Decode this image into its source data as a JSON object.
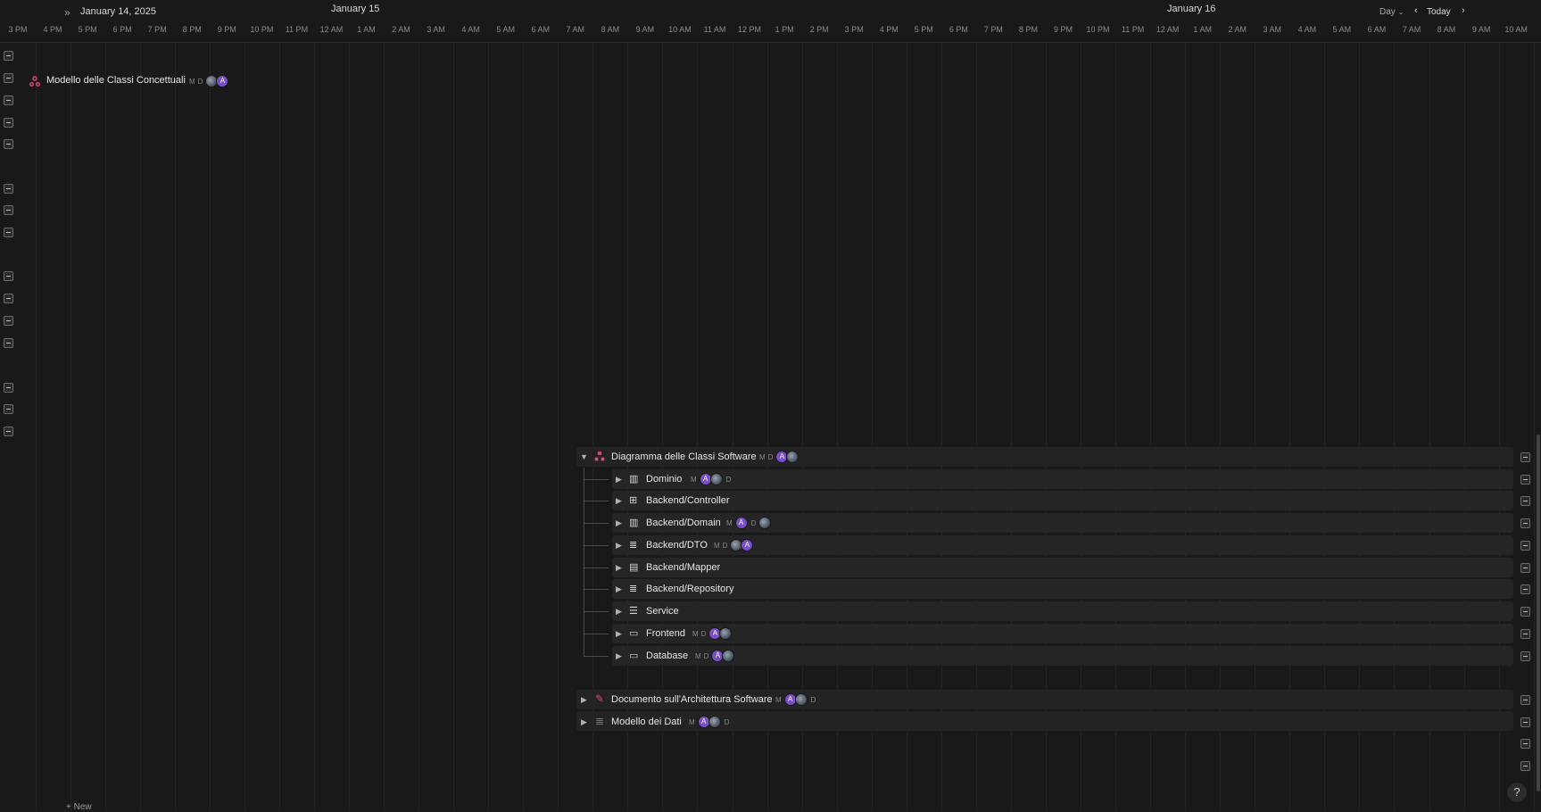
{
  "header": {
    "current_date": "January 14, 2025",
    "day_labels": [
      "January 15",
      "January 16"
    ],
    "view_mode": "Day",
    "today_label": "Today",
    "hours": [
      "3 PM",
      "4 PM",
      "5 PM",
      "6 PM",
      "7 PM",
      "8 PM",
      "9 PM",
      "10 PM",
      "11 PM",
      "12 AM",
      "1 AM",
      "2 AM",
      "3 AM",
      "4 AM",
      "5 AM",
      "6 AM",
      "7 AM",
      "8 AM",
      "9 AM",
      "10 AM",
      "11 AM",
      "12 PM",
      "1 PM",
      "2 PM",
      "3 PM",
      "4 PM",
      "5 PM",
      "6 PM",
      "7 PM",
      "8 PM",
      "9 PM",
      "10 PM",
      "11 PM",
      "12 AM",
      "1 AM",
      "2 AM",
      "3 AM",
      "4 AM",
      "5 AM",
      "6 AM",
      "7 AM",
      "8 AM",
      "9 AM",
      "10 AM"
    ]
  },
  "items": {
    "concept_model": {
      "label": "Modello delle Classi Concettuali",
      "icon": "class-diagram-icon",
      "color": "#e0457b"
    },
    "software_diagram": {
      "label": "Diagramma delle Classi Software",
      "icon": "class-diagram-icon",
      "color": "#e0457b"
    },
    "children": [
      {
        "label": "Dominio",
        "icon": "building-icon"
      },
      {
        "label": "Backend/Controller",
        "icon": "gamepad-icon"
      },
      {
        "label": "Backend/Domain",
        "icon": "building-icon"
      },
      {
        "label": "Backend/DTO",
        "icon": "database-icon"
      },
      {
        "label": "Backend/Mapper",
        "icon": "map-icon"
      },
      {
        "label": "Backend/Repository",
        "icon": "database-icon"
      },
      {
        "label": "Service",
        "icon": "list-icon"
      },
      {
        "label": "Frontend",
        "icon": "monitor-icon"
      },
      {
        "label": "Database",
        "icon": "monitor-icon"
      }
    ],
    "architecture_doc": {
      "label": "Documento sull'Architettura Software",
      "icon": "pen-icon",
      "color": "#e0457b"
    },
    "data_model": {
      "label": "Modello dei Dati",
      "icon": "database-icon",
      "color": "#e0457b"
    }
  },
  "avatar_text": {
    "m": "M",
    "d": "D",
    "a": "A"
  },
  "footer": {
    "new_label": "New",
    "help_label": "?"
  }
}
